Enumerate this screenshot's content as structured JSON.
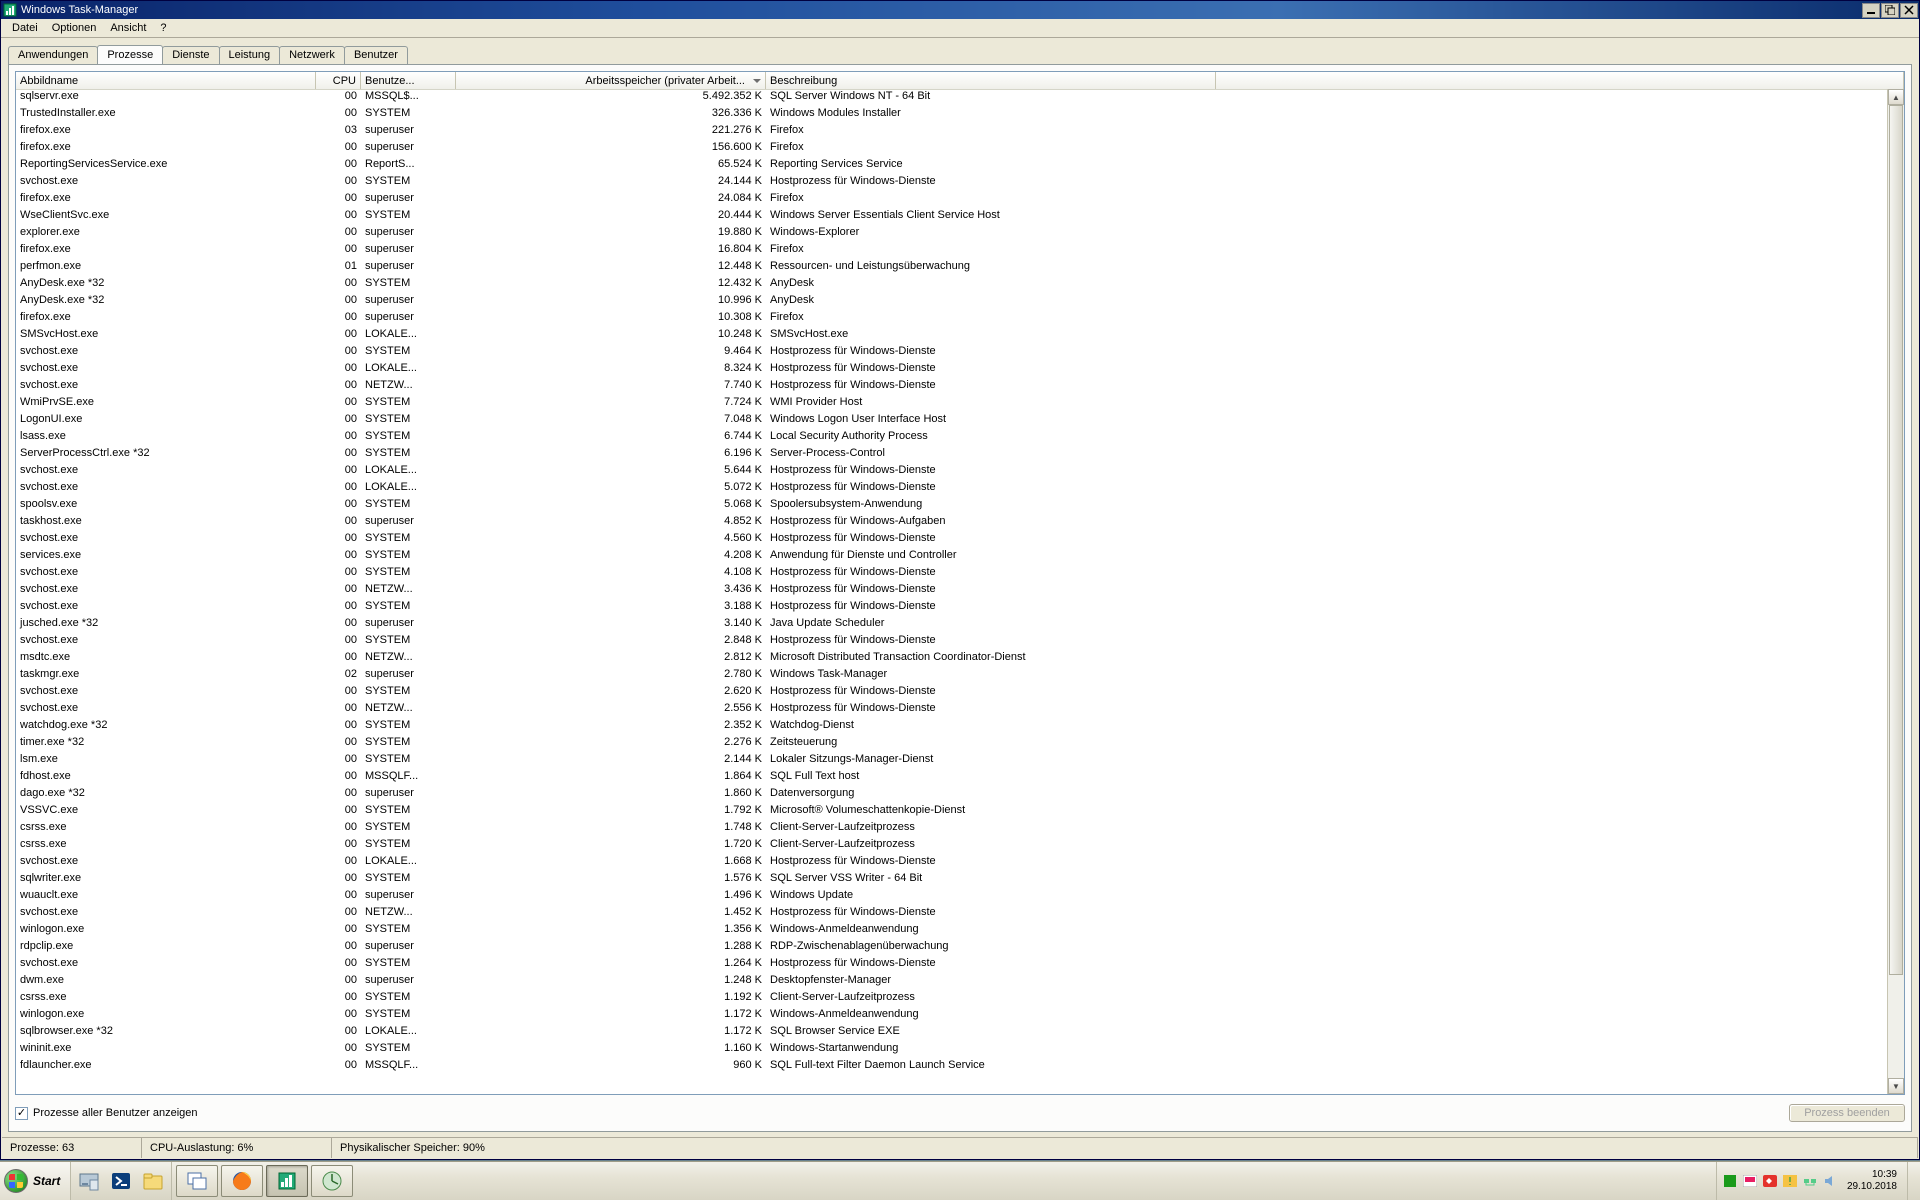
{
  "window": {
    "title": "Windows Task-Manager"
  },
  "menu": [
    "Datei",
    "Optionen",
    "Ansicht",
    "?"
  ],
  "tabs": [
    "Anwendungen",
    "Prozesse",
    "Dienste",
    "Leistung",
    "Netzwerk",
    "Benutzer"
  ],
  "active_tab_index": 1,
  "columns": {
    "name": "Abbildname",
    "cpu": "CPU",
    "user": "Benutze...",
    "mem": "Arbeitsspeicher (privater Arbeit...",
    "desc": "Beschreibung"
  },
  "rows": [
    {
      "name": "sqlservr.exe",
      "cpu": "00",
      "user": "MSSQL$...",
      "mem": "5.492.352 K",
      "desc": "SQL Server Windows NT - 64 Bit"
    },
    {
      "name": "TrustedInstaller.exe",
      "cpu": "00",
      "user": "SYSTEM",
      "mem": "326.336 K",
      "desc": "Windows Modules Installer"
    },
    {
      "name": "firefox.exe",
      "cpu": "03",
      "user": "superuser",
      "mem": "221.276 K",
      "desc": "Firefox"
    },
    {
      "name": "firefox.exe",
      "cpu": "00",
      "user": "superuser",
      "mem": "156.600 K",
      "desc": "Firefox"
    },
    {
      "name": "ReportingServicesService.exe",
      "cpu": "00",
      "user": "ReportS...",
      "mem": "65.524 K",
      "desc": "Reporting Services Service"
    },
    {
      "name": "svchost.exe",
      "cpu": "00",
      "user": "SYSTEM",
      "mem": "24.144 K",
      "desc": "Hostprozess für Windows-Dienste"
    },
    {
      "name": "firefox.exe",
      "cpu": "00",
      "user": "superuser",
      "mem": "24.084 K",
      "desc": "Firefox"
    },
    {
      "name": "WseClientSvc.exe",
      "cpu": "00",
      "user": "SYSTEM",
      "mem": "20.444 K",
      "desc": "Windows Server Essentials Client Service Host"
    },
    {
      "name": "explorer.exe",
      "cpu": "00",
      "user": "superuser",
      "mem": "19.880 K",
      "desc": "Windows-Explorer"
    },
    {
      "name": "firefox.exe",
      "cpu": "00",
      "user": "superuser",
      "mem": "16.804 K",
      "desc": "Firefox"
    },
    {
      "name": "perfmon.exe",
      "cpu": "01",
      "user": "superuser",
      "mem": "12.448 K",
      "desc": "Ressourcen- und Leistungsüberwachung"
    },
    {
      "name": "AnyDesk.exe *32",
      "cpu": "00",
      "user": "SYSTEM",
      "mem": "12.432 K",
      "desc": "AnyDesk"
    },
    {
      "name": "AnyDesk.exe *32",
      "cpu": "00",
      "user": "superuser",
      "mem": "10.996 K",
      "desc": "AnyDesk"
    },
    {
      "name": "firefox.exe",
      "cpu": "00",
      "user": "superuser",
      "mem": "10.308 K",
      "desc": "Firefox"
    },
    {
      "name": "SMSvcHost.exe",
      "cpu": "00",
      "user": "LOKALE...",
      "mem": "10.248 K",
      "desc": "SMSvcHost.exe"
    },
    {
      "name": "svchost.exe",
      "cpu": "00",
      "user": "SYSTEM",
      "mem": "9.464 K",
      "desc": "Hostprozess für Windows-Dienste"
    },
    {
      "name": "svchost.exe",
      "cpu": "00",
      "user": "LOKALE...",
      "mem": "8.324 K",
      "desc": "Hostprozess für Windows-Dienste"
    },
    {
      "name": "svchost.exe",
      "cpu": "00",
      "user": "NETZW...",
      "mem": "7.740 K",
      "desc": "Hostprozess für Windows-Dienste"
    },
    {
      "name": "WmiPrvSE.exe",
      "cpu": "00",
      "user": "SYSTEM",
      "mem": "7.724 K",
      "desc": "WMI Provider Host"
    },
    {
      "name": "LogonUI.exe",
      "cpu": "00",
      "user": "SYSTEM",
      "mem": "7.048 K",
      "desc": "Windows Logon User Interface Host"
    },
    {
      "name": "lsass.exe",
      "cpu": "00",
      "user": "SYSTEM",
      "mem": "6.744 K",
      "desc": "Local Security Authority Process"
    },
    {
      "name": "ServerProcessCtrl.exe *32",
      "cpu": "00",
      "user": "SYSTEM",
      "mem": "6.196 K",
      "desc": "Server-Process-Control"
    },
    {
      "name": "svchost.exe",
      "cpu": "00",
      "user": "LOKALE...",
      "mem": "5.644 K",
      "desc": "Hostprozess für Windows-Dienste"
    },
    {
      "name": "svchost.exe",
      "cpu": "00",
      "user": "LOKALE...",
      "mem": "5.072 K",
      "desc": "Hostprozess für Windows-Dienste"
    },
    {
      "name": "spoolsv.exe",
      "cpu": "00",
      "user": "SYSTEM",
      "mem": "5.068 K",
      "desc": "Spoolersubsystem-Anwendung"
    },
    {
      "name": "taskhost.exe",
      "cpu": "00",
      "user": "superuser",
      "mem": "4.852 K",
      "desc": "Hostprozess für Windows-Aufgaben"
    },
    {
      "name": "svchost.exe",
      "cpu": "00",
      "user": "SYSTEM",
      "mem": "4.560 K",
      "desc": "Hostprozess für Windows-Dienste"
    },
    {
      "name": "services.exe",
      "cpu": "00",
      "user": "SYSTEM",
      "mem": "4.208 K",
      "desc": "Anwendung für Dienste und Controller"
    },
    {
      "name": "svchost.exe",
      "cpu": "00",
      "user": "SYSTEM",
      "mem": "4.108 K",
      "desc": "Hostprozess für Windows-Dienste"
    },
    {
      "name": "svchost.exe",
      "cpu": "00",
      "user": "NETZW...",
      "mem": "3.436 K",
      "desc": "Hostprozess für Windows-Dienste"
    },
    {
      "name": "svchost.exe",
      "cpu": "00",
      "user": "SYSTEM",
      "mem": "3.188 K",
      "desc": "Hostprozess für Windows-Dienste"
    },
    {
      "name": "jusched.exe *32",
      "cpu": "00",
      "user": "superuser",
      "mem": "3.140 K",
      "desc": "Java Update Scheduler"
    },
    {
      "name": "svchost.exe",
      "cpu": "00",
      "user": "SYSTEM",
      "mem": "2.848 K",
      "desc": "Hostprozess für Windows-Dienste"
    },
    {
      "name": "msdtc.exe",
      "cpu": "00",
      "user": "NETZW...",
      "mem": "2.812 K",
      "desc": "Microsoft Distributed Transaction Coordinator-Dienst"
    },
    {
      "name": "taskmgr.exe",
      "cpu": "02",
      "user": "superuser",
      "mem": "2.780 K",
      "desc": "Windows Task-Manager"
    },
    {
      "name": "svchost.exe",
      "cpu": "00",
      "user": "SYSTEM",
      "mem": "2.620 K",
      "desc": "Hostprozess für Windows-Dienste"
    },
    {
      "name": "svchost.exe",
      "cpu": "00",
      "user": "NETZW...",
      "mem": "2.556 K",
      "desc": "Hostprozess für Windows-Dienste"
    },
    {
      "name": "watchdog.exe *32",
      "cpu": "00",
      "user": "SYSTEM",
      "mem": "2.352 K",
      "desc": "Watchdog-Dienst"
    },
    {
      "name": "timer.exe *32",
      "cpu": "00",
      "user": "SYSTEM",
      "mem": "2.276 K",
      "desc": "Zeitsteuerung"
    },
    {
      "name": "lsm.exe",
      "cpu": "00",
      "user": "SYSTEM",
      "mem": "2.144 K",
      "desc": "Lokaler Sitzungs-Manager-Dienst"
    },
    {
      "name": "fdhost.exe",
      "cpu": "00",
      "user": "MSSQLF...",
      "mem": "1.864 K",
      "desc": "SQL Full Text host"
    },
    {
      "name": "dago.exe *32",
      "cpu": "00",
      "user": "superuser",
      "mem": "1.860 K",
      "desc": "Datenversorgung"
    },
    {
      "name": "VSSVC.exe",
      "cpu": "00",
      "user": "SYSTEM",
      "mem": "1.792 K",
      "desc": "Microsoft® Volumeschattenkopie-Dienst"
    },
    {
      "name": "csrss.exe",
      "cpu": "00",
      "user": "SYSTEM",
      "mem": "1.748 K",
      "desc": "Client-Server-Laufzeitprozess"
    },
    {
      "name": "csrss.exe",
      "cpu": "00",
      "user": "SYSTEM",
      "mem": "1.720 K",
      "desc": "Client-Server-Laufzeitprozess"
    },
    {
      "name": "svchost.exe",
      "cpu": "00",
      "user": "LOKALE...",
      "mem": "1.668 K",
      "desc": "Hostprozess für Windows-Dienste"
    },
    {
      "name": "sqlwriter.exe",
      "cpu": "00",
      "user": "SYSTEM",
      "mem": "1.576 K",
      "desc": "SQL Server VSS Writer - 64 Bit"
    },
    {
      "name": "wuauclt.exe",
      "cpu": "00",
      "user": "superuser",
      "mem": "1.496 K",
      "desc": "Windows Update"
    },
    {
      "name": "svchost.exe",
      "cpu": "00",
      "user": "NETZW...",
      "mem": "1.452 K",
      "desc": "Hostprozess für Windows-Dienste"
    },
    {
      "name": "winlogon.exe",
      "cpu": "00",
      "user": "SYSTEM",
      "mem": "1.356 K",
      "desc": "Windows-Anmeldeanwendung"
    },
    {
      "name": "rdpclip.exe",
      "cpu": "00",
      "user": "superuser",
      "mem": "1.288 K",
      "desc": "RDP-Zwischenablagenüberwachung"
    },
    {
      "name": "svchost.exe",
      "cpu": "00",
      "user": "SYSTEM",
      "mem": "1.264 K",
      "desc": "Hostprozess für Windows-Dienste"
    },
    {
      "name": "dwm.exe",
      "cpu": "00",
      "user": "superuser",
      "mem": "1.248 K",
      "desc": "Desktopfenster-Manager"
    },
    {
      "name": "csrss.exe",
      "cpu": "00",
      "user": "SYSTEM",
      "mem": "1.192 K",
      "desc": "Client-Server-Laufzeitprozess"
    },
    {
      "name": "winlogon.exe",
      "cpu": "00",
      "user": "SYSTEM",
      "mem": "1.172 K",
      "desc": "Windows-Anmeldeanwendung"
    },
    {
      "name": "sqlbrowser.exe *32",
      "cpu": "00",
      "user": "LOKALE...",
      "mem": "1.172 K",
      "desc": "SQL Browser Service EXE"
    },
    {
      "name": "wininit.exe",
      "cpu": "00",
      "user": "SYSTEM",
      "mem": "1.160 K",
      "desc": "Windows-Startanwendung"
    },
    {
      "name": "fdlauncher.exe",
      "cpu": "00",
      "user": "MSSQLF...",
      "mem": "960 K",
      "desc": "SQL Full-text Filter Daemon Launch Service"
    }
  ],
  "checkbox_label": "Prozesse aller Benutzer anzeigen",
  "end_button": "Prozess beenden",
  "status": {
    "processes": "Prozesse: 63",
    "cpu": "CPU-Auslastung: 6%",
    "mem": "Physikalischer Speicher: 90%"
  },
  "taskbar": {
    "start": "Start",
    "clock_time": "10:39",
    "clock_date": "29.10.2018"
  }
}
